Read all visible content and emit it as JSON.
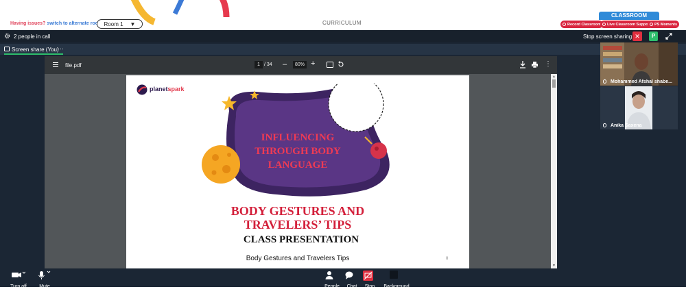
{
  "top": {
    "issues_text": "Having issues?",
    "switch_link": "switch to alternate room",
    "room_label": "Room 1",
    "curriculum_label": "CURRICULUM",
    "classroom_tab": "CLASSROOM",
    "pills": [
      "Record Classroom",
      "Live Classroom Support",
      "PS Moments"
    ]
  },
  "call": {
    "people_count": "2 people in call",
    "stop_sharing": "Stop screen sharing",
    "stop_x": "✕",
    "p_label": "P"
  },
  "share": {
    "label": "Screen share (You)",
    "more": "···"
  },
  "viewer": {
    "filename": "file.pdf",
    "current_page": "1",
    "total_pages": "/ 34",
    "zoom": "80%",
    "zoom_minus": "–",
    "zoom_plus": "+",
    "more": "⋮"
  },
  "slide": {
    "brand": "planet",
    "brand_accent": "spark",
    "title": "INFLUENCING\nTHROUGH BODY\nLANGUAGE",
    "headline": "BODY GESTURES AND\nTRAVELERS’ TIPS",
    "subhead": "CLASS PRESENTATION",
    "footer": "Body Gestures and Travelers Tips",
    "page_number": "0"
  },
  "participants": [
    {
      "name": "Mohammed Afshal shabe..."
    },
    {
      "name": "Anika Saxena"
    }
  ],
  "bottom": {
    "turn_off": "Turn off",
    "mute": "Mute",
    "people": "People",
    "chat": "Chat",
    "stop": "Stop",
    "background": "Background"
  },
  "colors": {
    "brand_red": "#d31f3a",
    "purple": "#4a2a6e",
    "accent_blue": "#2f8ad8",
    "green": "#2dbe6c"
  }
}
